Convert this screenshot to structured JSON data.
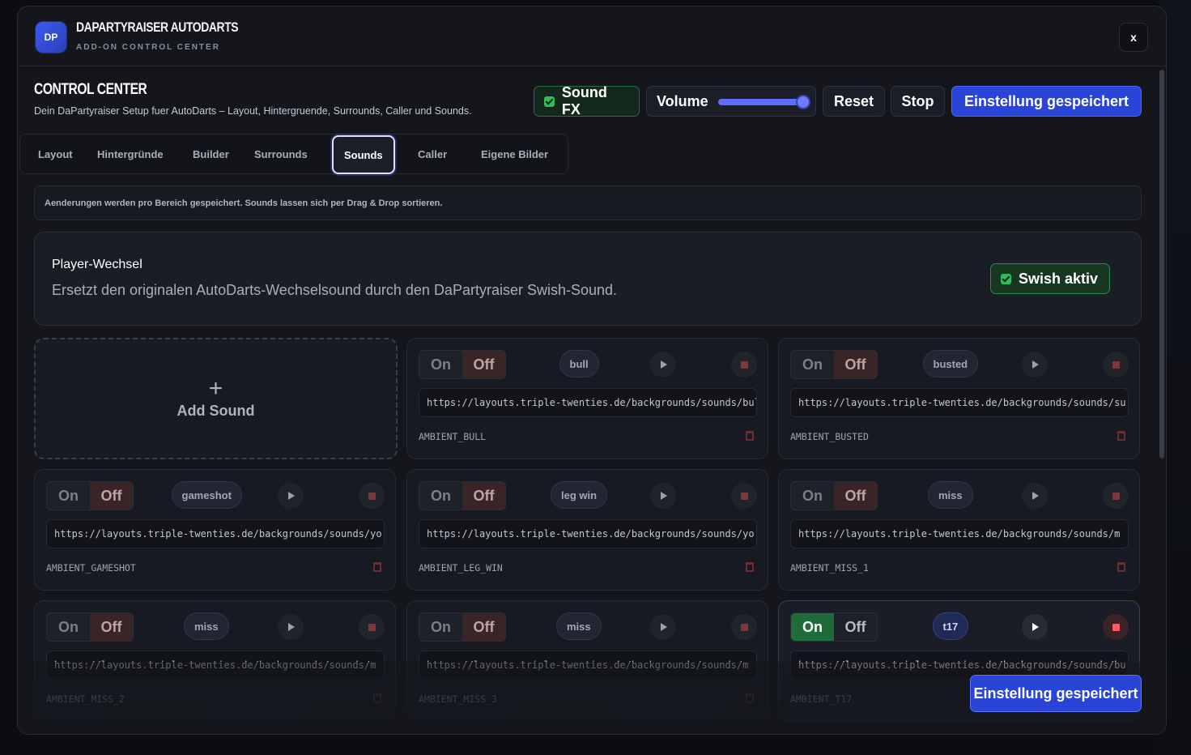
{
  "app": {
    "logo": "DP",
    "title": "DAPARTYRAISER AUTODARTS",
    "subtitle": "ADD-ON CONTROL CENTER",
    "close_label": "x"
  },
  "header": {
    "title": "CONTROL CENTER",
    "description": "Dein DaPartyraiser Setup fuer AutoDarts – Layout, Hintergruende, Surrounds, Caller und Sounds.",
    "sound_fx_label": "Sound FX",
    "sound_fx_checked": true,
    "volume_label": "Volume",
    "volume_level": 1.0,
    "reset_label": "Reset",
    "stop_label": "Stop",
    "saved_label": "Einstellung gespeichert"
  },
  "tabs": [
    {
      "label": "Layout",
      "active": false
    },
    {
      "label": "Hintergründe",
      "active": false
    },
    {
      "label": "Builder",
      "active": false
    },
    {
      "label": "Surrounds",
      "active": false
    },
    {
      "label": "Sounds",
      "active": true
    },
    {
      "label": "Caller",
      "active": false
    },
    {
      "label": "Eigene Bilder",
      "active": false
    }
  ],
  "notice": "Aenderungen werden pro Bereich gespeichert. Sounds lassen sich per Drag & Drop sortieren.",
  "player_switch": {
    "title": "Player-Wechsel",
    "description": "Ersetzt den originalen AutoDarts-Wechselsound durch den DaPartyraiser Swish-Sound.",
    "toggle_label": "Swish aktiv",
    "toggle_checked": true
  },
  "add_sound": {
    "plus": "+",
    "label": "Add Sound"
  },
  "sound_cards": [
    {
      "on_label": "On",
      "off_label": "Off",
      "enabled": false,
      "tag": "bull",
      "url": "https://layouts.triple-twenties.de/backgrounds/sounds/bull",
      "key": "AMBIENT_BULL"
    },
    {
      "on_label": "On",
      "off_label": "Off",
      "enabled": false,
      "tag": "busted",
      "url": "https://layouts.triple-twenties.de/backgrounds/sounds/su",
      "key": "AMBIENT_BUSTED"
    },
    {
      "on_label": "On",
      "off_label": "Off",
      "enabled": false,
      "tag": "gameshot",
      "url": "https://layouts.triple-twenties.de/backgrounds/sounds/yo",
      "key": "AMBIENT_GAMESHOT"
    },
    {
      "on_label": "On",
      "off_label": "Off",
      "enabled": false,
      "tag": "leg win",
      "url": "https://layouts.triple-twenties.de/backgrounds/sounds/yo",
      "key": "AMBIENT_LEG_WIN"
    },
    {
      "on_label": "On",
      "off_label": "Off",
      "enabled": false,
      "tag": "miss",
      "url": "https://layouts.triple-twenties.de/backgrounds/sounds/m",
      "key": "AMBIENT_MISS_1"
    },
    {
      "on_label": "On",
      "off_label": "Off",
      "enabled": false,
      "tag": "miss",
      "url": "https://layouts.triple-twenties.de/backgrounds/sounds/m",
      "key": "AMBIENT_MISS_2"
    },
    {
      "on_label": "On",
      "off_label": "Off",
      "enabled": false,
      "tag": "miss",
      "url": "https://layouts.triple-twenties.de/backgrounds/sounds/m",
      "key": "AMBIENT_MISS_3"
    },
    {
      "on_label": "On",
      "off_label": "Off",
      "enabled": true,
      "tag": "t17",
      "url": "https://layouts.triple-twenties.de/backgrounds/sounds/bu",
      "key": "AMBIENT_T17"
    }
  ],
  "toast": "Einstellung gespeichert",
  "icons": {
    "play": "play-icon",
    "stop": "stop-icon",
    "trash": "trash-icon",
    "check": "checkbox-icon",
    "close": "close-icon"
  }
}
